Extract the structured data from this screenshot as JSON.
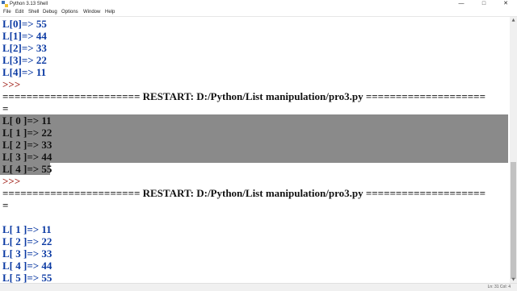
{
  "window": {
    "title": "Python 3.13 Shell",
    "minimize_glyph": "—",
    "maximize_glyph": "□",
    "close_glyph": "✕"
  },
  "menu": [
    "File",
    "Edit",
    "Shell",
    "Debug",
    "Options",
    "Window",
    "Help"
  ],
  "shell_lines": [
    {
      "text": "L[0]=> 55",
      "kind": "out"
    },
    {
      "text": "L[1]=> 44",
      "kind": "out"
    },
    {
      "text": "L[2]=> 33",
      "kind": "out"
    },
    {
      "text": "L[3]=> 22",
      "kind": "out"
    },
    {
      "text": "L[4]=> 11",
      "kind": "out"
    },
    {
      "text": ">>>",
      "kind": "prompt"
    },
    {
      "text": "======================= RESTART: D:/Python/List manipulation/pro3.py ====================",
      "kind": "restart"
    },
    {
      "text": "=",
      "kind": "restart"
    },
    {
      "text": "L[ 0 ]=> 11",
      "kind": "out"
    },
    {
      "text": "L[ 1 ]=> 22",
      "kind": "out"
    },
    {
      "text": "L[ 2 ]=> 33",
      "kind": "out"
    },
    {
      "text": "L[ 3 ]=> 44",
      "kind": "out"
    },
    {
      "text": "L[ 4 ]=> 55",
      "kind": "out"
    },
    {
      "text": ">>>",
      "kind": "prompt"
    },
    {
      "text": "======================= RESTART: D:/Python/List manipulation/pro3.py ====================",
      "kind": "restart"
    },
    {
      "text": "=",
      "kind": "restart"
    },
    {
      "text": "",
      "kind": "out"
    },
    {
      "text": "L[ 1 ]=> 11",
      "kind": "out"
    },
    {
      "text": "L[ 2 ]=> 22",
      "kind": "out"
    },
    {
      "text": "L[ 3 ]=> 33",
      "kind": "out"
    },
    {
      "text": "L[ 4 ]=> 44",
      "kind": "out"
    },
    {
      "text": "L[ 5 ]=> 55",
      "kind": "out"
    },
    {
      "text": ">>>",
      "kind": "prompt"
    }
  ],
  "status": {
    "position": "Ln: 31  Col: 4"
  }
}
